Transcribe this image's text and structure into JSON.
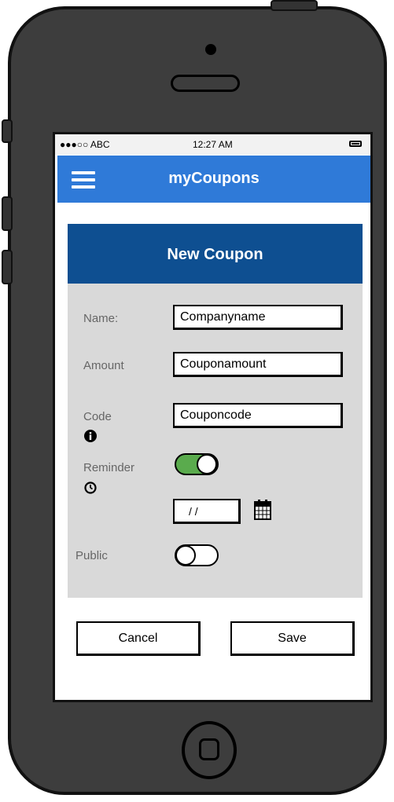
{
  "status_bar": {
    "carrier": "●●●○○ ABC",
    "time": "12:27 AM"
  },
  "app_bar": {
    "title": "myCoupons",
    "menu_icon": "hamburger-icon"
  },
  "form": {
    "title": "New Coupon",
    "name_label": "Name:",
    "name_value": "Companyname",
    "amount_label": "Amount",
    "amount_value": "Couponamount",
    "code_label": "Code",
    "code_value": "Couponcode",
    "code_icon": "info-icon",
    "reminder_label": "Reminder",
    "reminder_icon": "clock-icon",
    "reminder_on": true,
    "reminder_date": "/ /",
    "calendar_icon": "calendar-icon",
    "public_label": "Public",
    "public_on": false
  },
  "actions": {
    "cancel_label": "Cancel",
    "save_label": "Save"
  },
  "colors": {
    "app_bar": "#2f7ad8",
    "form_header": "#0e4f91",
    "toggle_on": "#5aab4d",
    "panel": "#d9d9d9",
    "phone_body": "#3d3d3d"
  }
}
